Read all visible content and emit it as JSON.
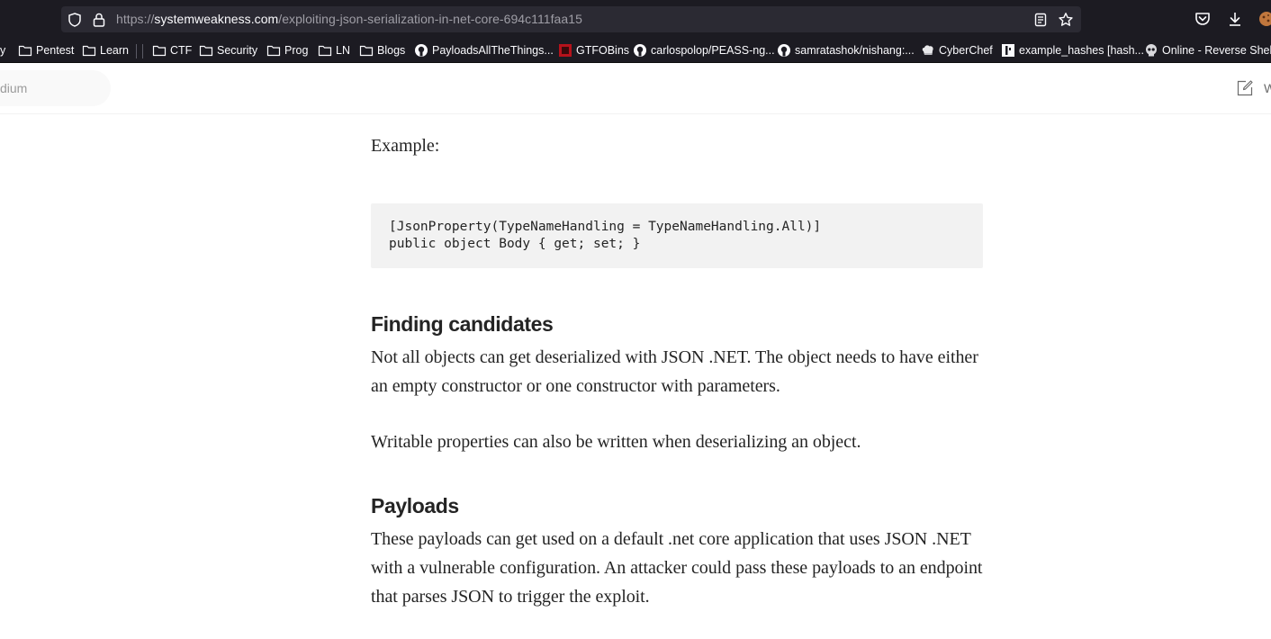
{
  "browser": {
    "url_scheme": "https://",
    "url_host": "systemweakness.com",
    "url_path": "/exploiting-json-serialization-in-net-core-694c111faa15",
    "bookmarks": [
      {
        "label": "y",
        "icon": "folder-icon"
      },
      {
        "label": "Pentest",
        "icon": "folder-icon"
      },
      {
        "label": "Learn",
        "icon": "folder-icon"
      },
      {
        "label": "CTF",
        "icon": "folder-icon"
      },
      {
        "label": "Security",
        "icon": "folder-icon"
      },
      {
        "label": "Prog",
        "icon": "folder-icon"
      },
      {
        "label": "LN",
        "icon": "folder-icon"
      },
      {
        "label": "Blogs",
        "icon": "folder-icon"
      },
      {
        "label": "PayloadsAllTheThings...",
        "icon": "github-icon"
      },
      {
        "label": "GTFOBins",
        "icon": "gtfobins-icon"
      },
      {
        "label": "carlospolop/PEASS-ng...",
        "icon": "github-icon"
      },
      {
        "label": "samratashok/nishang:...",
        "icon": "github-icon"
      },
      {
        "label": "CyberChef",
        "icon": "chef-hat-icon"
      },
      {
        "label": "example_hashes [hash...",
        "icon": "hashcat-icon"
      },
      {
        "label": "Online - Reverse Shell ...",
        "icon": "skull-icon"
      }
    ]
  },
  "header": {
    "search_placeholder": "dium",
    "write_label": "W"
  },
  "article": {
    "example_label": "Example:",
    "code_line_1": "[JsonProperty(TypeNameHandling = TypeNameHandling.All)]",
    "code_line_2": "public object Body { get; set; }",
    "heading_finding": "Finding candidates",
    "para_finding_1": "Not all objects can get deserialized with JSON .NET. The object needs to have either an empty constructor or one constructor with parameters.",
    "para_finding_2": "Writable properties can also be written when deserializing an object.",
    "heading_payloads": "Payloads",
    "para_payloads": "These payloads can get used on a default .net core application that uses JSON .NET with a vulnerable configuration. An attacker could pass these payloads to an endpoint that parses JSON to trigger the exploit."
  }
}
